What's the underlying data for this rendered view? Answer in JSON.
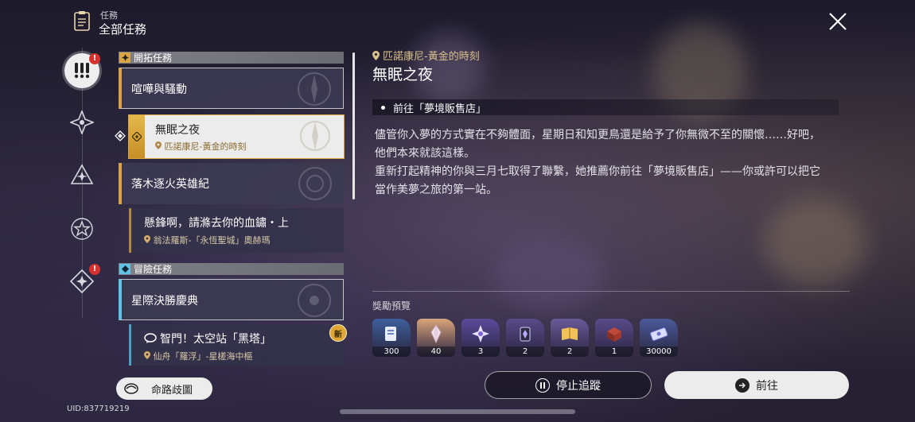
{
  "header": {
    "section": "任務",
    "title": "全部任務"
  },
  "rail": {
    "badge_1": "!",
    "badge_2": "!"
  },
  "categories": {
    "trailblaze": "開拓任務",
    "adventure": "冒險任務"
  },
  "quests": {
    "q1": {
      "title": "喧嘩與騷動"
    },
    "q2": {
      "title": "無眠之夜",
      "location": "匹諾康尼-黃金的時刻"
    },
    "q3": {
      "title": "落木逐火英雄紀"
    },
    "q4": {
      "title": "懸鋒啊，請滌去你的血鏽・上",
      "location": "翁法羅斯-「永恆聖城」奧赫瑪"
    },
    "q5": {
      "title": "星際決勝慶典"
    },
    "q6": {
      "title": "智門！太空站「黑塔」",
      "location": "仙舟「羅浮」-星槎海中樞",
      "new_badge": "新"
    }
  },
  "bottom_left": {
    "route_button": "命路歧圖",
    "uid": "UID:837719219"
  },
  "detail": {
    "location": "匹諾康尼-黃金的時刻",
    "title": "無眠之夜",
    "objective": "前往「夢境販售店」",
    "description": [
      "儘管你入夢的方式實在不夠體面，星期日和知更鳥還是給予了你無微不至的關懷……好吧，",
      "他們本來就該這樣。",
      "重新打起精神的你與三月七取得了聯繫，她推薦你前往「夢境販售店」——你或許可以把它",
      "當作美夢之旅的第一站。"
    ],
    "rewards_title": "獎勵預覽",
    "rewards": [
      {
        "qty": "300",
        "icon": "exp-material-icon",
        "color": "#3d5f9a"
      },
      {
        "qty": "40",
        "icon": "stellar-jade-icon",
        "color": "#d9a47a"
      },
      {
        "qty": "3",
        "icon": "star-rail-pass-icon",
        "color": "#5a4a9a"
      },
      {
        "qty": "2",
        "icon": "fuel-material-icon",
        "color": "#5a4a8a"
      },
      {
        "qty": "2",
        "icon": "book-material-icon",
        "color": "#6a5a9a"
      },
      {
        "qty": "1",
        "icon": "relic-box-icon",
        "color": "#5a4a8a"
      },
      {
        "qty": "30000",
        "icon": "credit-icon",
        "color": "#4a5a9a"
      }
    ],
    "stop_button": "停止追蹤",
    "go_button": "前往"
  }
}
